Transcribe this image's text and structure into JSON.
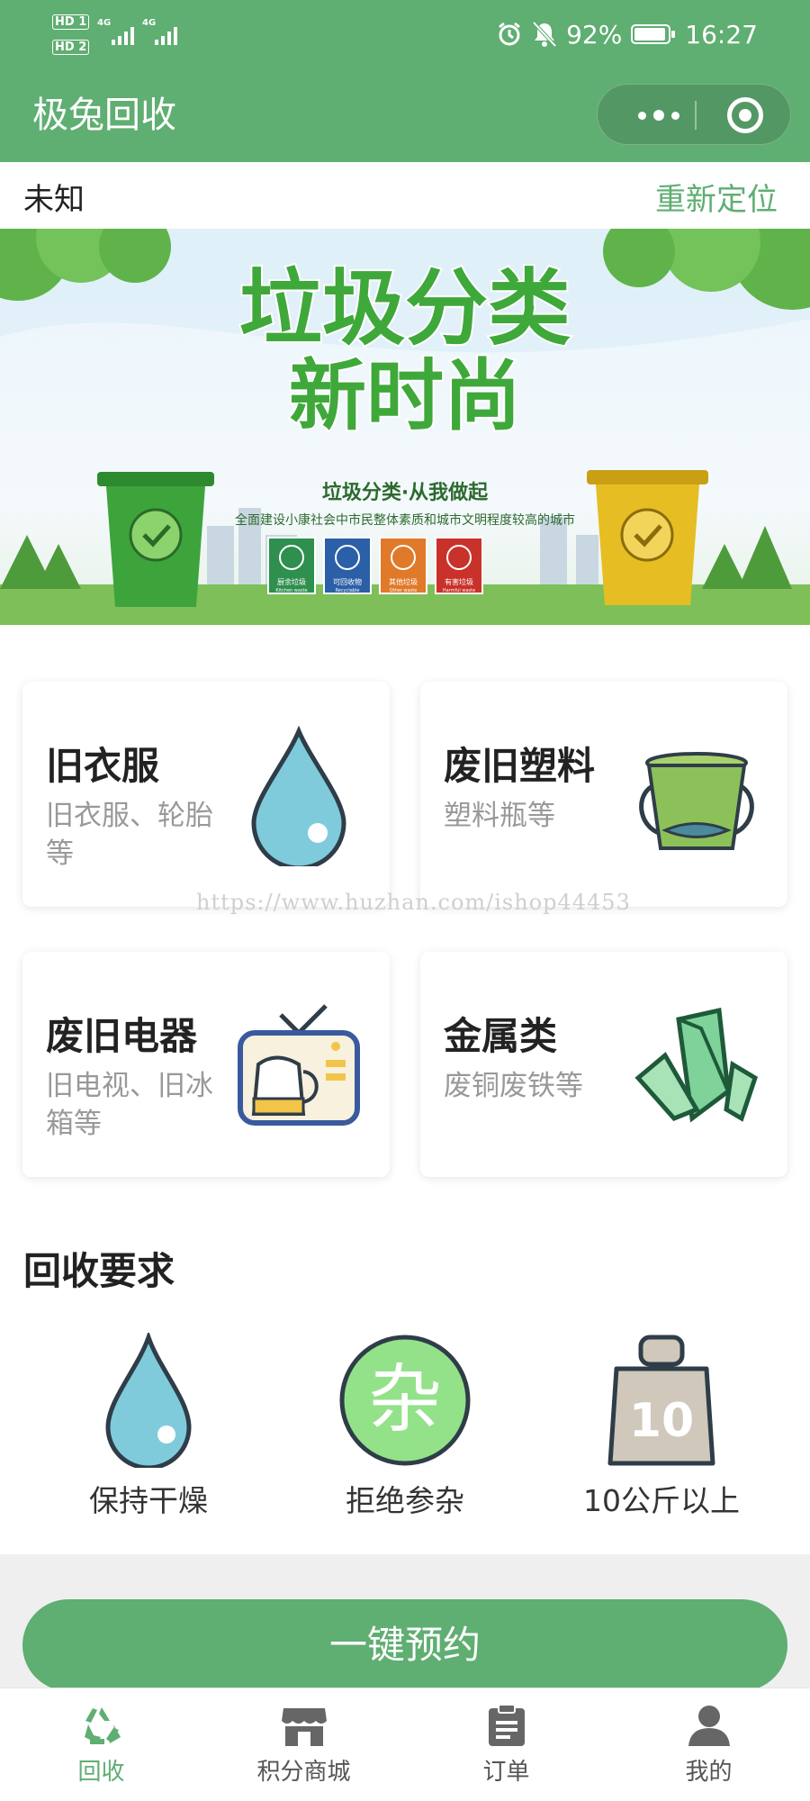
{
  "status_bar": {
    "sim1": "HD 1",
    "sim2": "HD 2",
    "network1": "4G",
    "network2": "4G",
    "battery_percent": "92%",
    "time": "16:27",
    "icons": [
      "alarm-icon",
      "mute-bell-icon",
      "battery-icon"
    ]
  },
  "header": {
    "title": "极兔回收",
    "menu_icon": "more-dots-icon",
    "close_icon": "target-icon"
  },
  "location": {
    "city": "未知",
    "relocate_label": "重新定位"
  },
  "banner": {
    "headline_line1": "垃圾分类",
    "headline_line2": "新时尚",
    "slogan": "垃圾分类·从我做起",
    "subtitle": "全面建设小康社会中市民整体素质和城市文明程度较高的城市",
    "bins": [
      {
        "label": "厨余垃圾",
        "sub": "Kitchen waste",
        "color": "#2f8f4e"
      },
      {
        "label": "可回收物",
        "sub": "Recyclable",
        "color": "#2b5fa8"
      },
      {
        "label": "其他垃圾",
        "sub": "Other waste",
        "color": "#e07a2a"
      },
      {
        "label": "有害垃圾",
        "sub": "Harmful waste",
        "color": "#c8322b"
      }
    ]
  },
  "categories": [
    {
      "title": "旧衣服",
      "desc": "旧衣服、轮胎等",
      "icon": "water-drop-icon"
    },
    {
      "title": "废旧塑料",
      "desc": "塑料瓶等",
      "icon": "bucket-icon"
    },
    {
      "title": "废旧电器",
      "desc": "旧电视、旧冰箱等",
      "icon": "tv-kettle-icon"
    },
    {
      "title": "金属类",
      "desc": "废铜废铁等",
      "icon": "crystal-icon"
    }
  ],
  "watermark": "https://www.huzhan.com/ishop44453",
  "requirements": {
    "title": "回收要求",
    "items": [
      {
        "label": "保持干燥",
        "icon": "water-drop-icon"
      },
      {
        "label": "拒绝参杂",
        "icon_text": "杂",
        "icon": "mixed-circle-icon"
      },
      {
        "label": "10公斤以上",
        "icon_text": "10",
        "icon": "weight-icon"
      }
    ]
  },
  "cta": {
    "label": "一键预约"
  },
  "tabbar": {
    "items": [
      {
        "label": "回收",
        "icon": "recycle-icon",
        "active": true
      },
      {
        "label": "积分商城",
        "icon": "store-icon",
        "active": false
      },
      {
        "label": "订单",
        "icon": "clipboard-icon",
        "active": false
      },
      {
        "label": "我的",
        "icon": "user-icon",
        "active": false
      }
    ]
  },
  "colors": {
    "primary": "#5fae72",
    "muted_text": "#999999",
    "drop_blue": "#7fcbdc",
    "tab_inactive": "#888888"
  }
}
